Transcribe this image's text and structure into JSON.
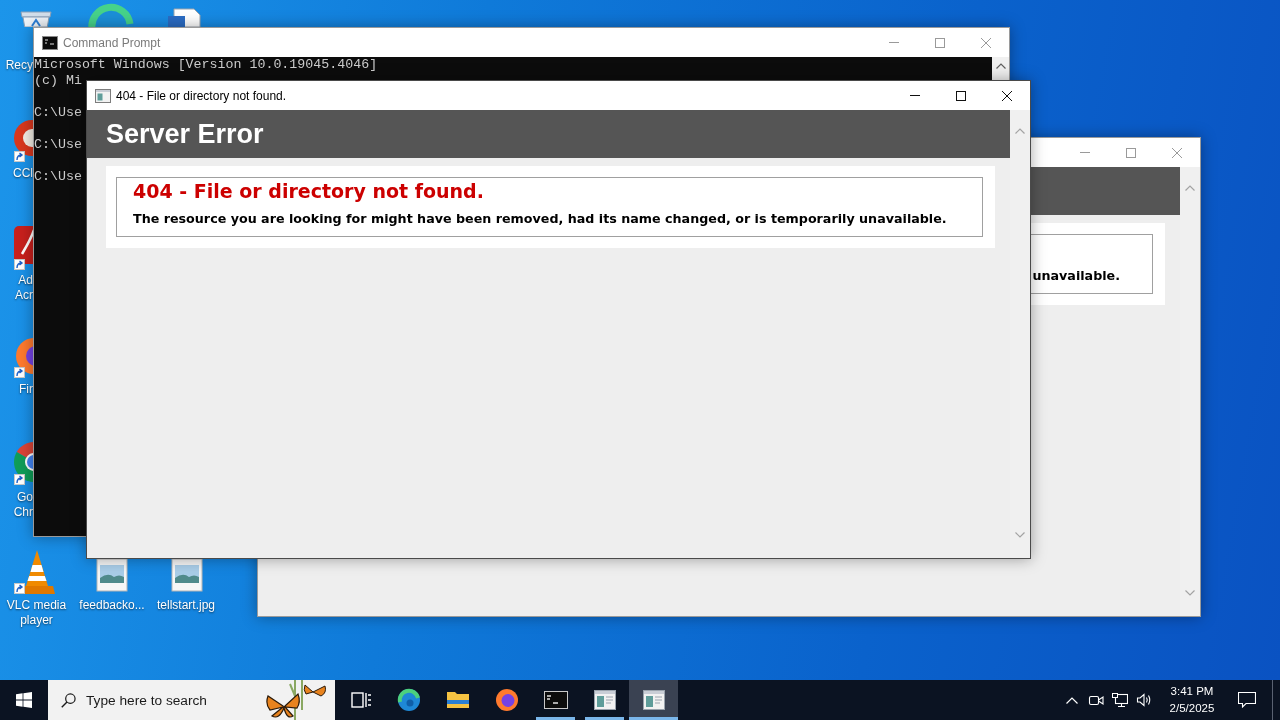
{
  "desktop": {
    "icons": [
      {
        "kind": "recycle-bin",
        "label": "Recy",
        "shortcut": false
      },
      {
        "kind": "swirl",
        "shortcut": false
      },
      {
        "kind": "document",
        "shortcut": false
      },
      {
        "kind": "cleaner",
        "label": "CCl",
        "shortcut": true
      },
      {
        "kind": "pdf",
        "label": "Ad Acr",
        "shortcut": true
      },
      {
        "kind": "fox",
        "label": "Fir",
        "shortcut": true
      },
      {
        "kind": "ring",
        "label": "Go Chr",
        "shortcut": true
      },
      {
        "kind": "cone",
        "label": "VLC media player",
        "shortcut": true
      },
      {
        "kind": "image",
        "label": "feedbacko...",
        "shortcut": false
      },
      {
        "kind": "image",
        "label": "tellstart.jpg",
        "shortcut": false
      }
    ]
  },
  "windows": [
    {
      "kind": "console",
      "title": "Command Prompt",
      "active": false,
      "lines": [
        {
          "kind": "output",
          "text": "Microsoft Windows [Version 10.0.19045.4046]"
        },
        {
          "kind": "output",
          "text": "(c) Mi"
        },
        {
          "kind": "prompt",
          "text": "C:\\Use"
        },
        {
          "kind": "prompt",
          "text": "C:\\Use"
        },
        {
          "kind": "prompt",
          "text": "C:\\Use"
        }
      ]
    },
    {
      "kind": "browser",
      "title": "404 - File or directory not found.",
      "active": true,
      "header": "Server Error",
      "error_heading": "404 - File or directory not found.",
      "error_text": "The resource you are looking for might have been removed, had its name changed, or is temporarily unavailable."
    },
    {
      "kind": "browser",
      "active": false,
      "error_text": "unavailable."
    }
  ],
  "taskbar": {
    "search": {
      "placeholder": "Type here to search"
    },
    "apps": [
      {
        "kind": "task-view",
        "running": false,
        "selected": false
      },
      {
        "kind": "swirl",
        "running": false,
        "selected": false
      },
      {
        "kind": "folder",
        "running": false,
        "selected": false
      },
      {
        "kind": "fox",
        "running": false,
        "selected": false
      },
      {
        "kind": "terminal",
        "running": true,
        "selected": false
      },
      {
        "kind": "window",
        "running": true,
        "selected": false
      },
      {
        "kind": "window",
        "running": true,
        "selected": true
      }
    ],
    "clock": {
      "time": "3:41 PM",
      "date": "2/5/2025"
    }
  }
}
